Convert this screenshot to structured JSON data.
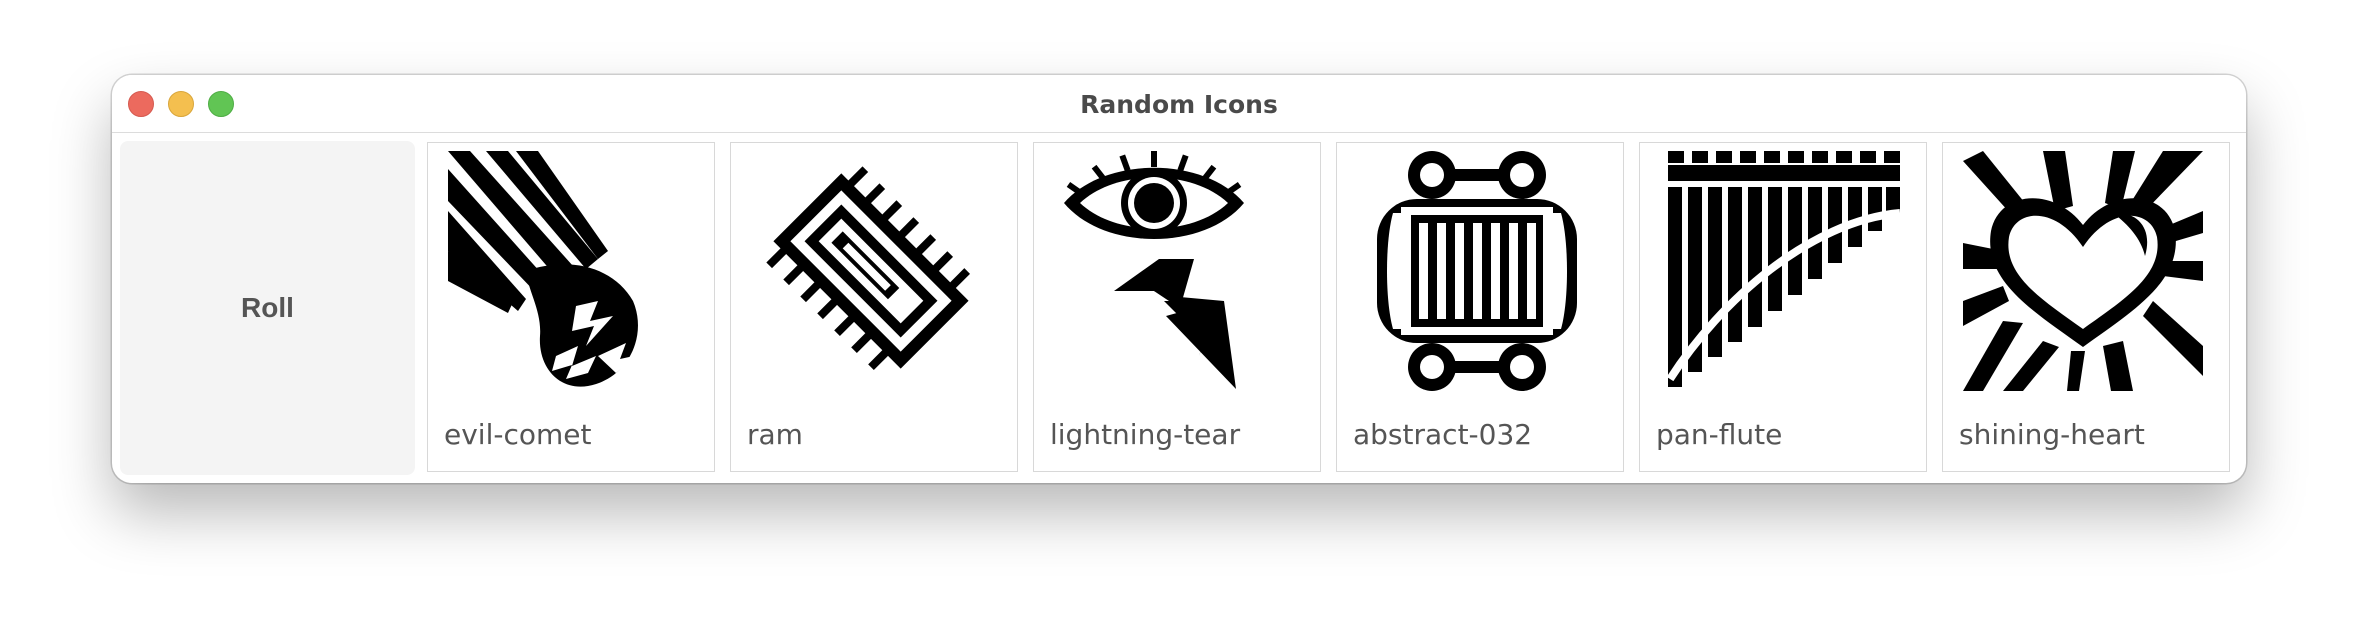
{
  "window": {
    "title": "Random Icons"
  },
  "roll_button": {
    "label": "Roll"
  },
  "icons": [
    {
      "label": "evil-comet",
      "icon": "evil-comet-icon"
    },
    {
      "label": "ram",
      "icon": "ram-icon"
    },
    {
      "label": "lightning-tear",
      "icon": "lightning-tear-icon"
    },
    {
      "label": "abstract-032",
      "icon": "abstract-032-icon"
    },
    {
      "label": "pan-flute",
      "icon": "pan-flute-icon"
    },
    {
      "label": "shining-heart",
      "icon": "shining-heart-icon"
    }
  ]
}
